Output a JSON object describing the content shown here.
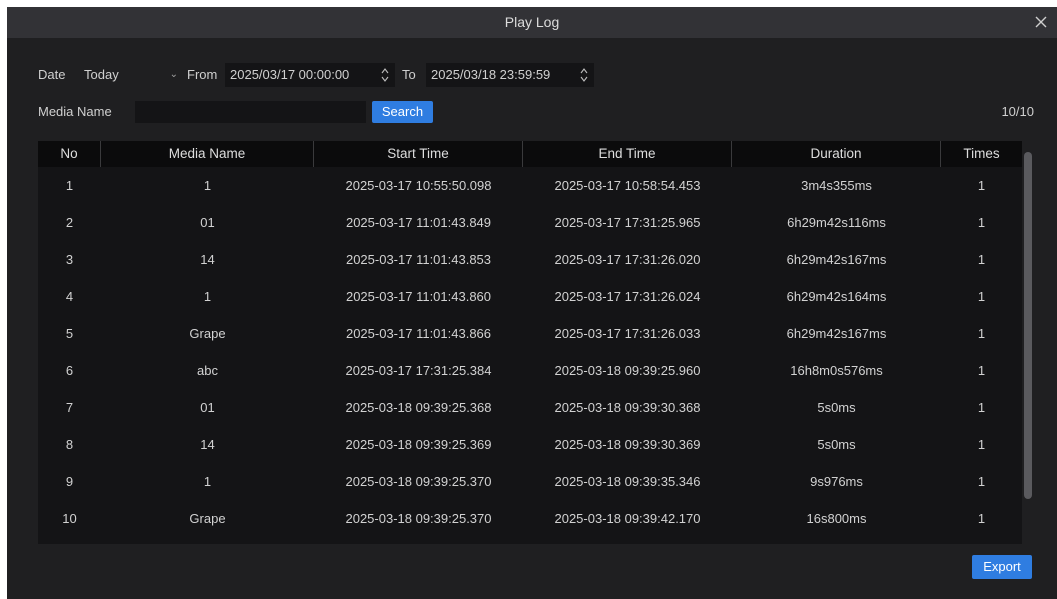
{
  "window": {
    "title": "Play Log"
  },
  "filters": {
    "date_label": "Date",
    "date_value": "Today",
    "from_label": "From",
    "from_value": "2025/03/17 00:00:00",
    "to_label": "To",
    "to_value": "2025/03/18 23:59:59",
    "media_name_label": "Media Name",
    "media_name_value": "",
    "search_label": "Search",
    "count": "10/10"
  },
  "table": {
    "columns": [
      "No",
      "Media Name",
      "Start Time",
      "End Time",
      "Duration",
      "Times"
    ],
    "rows": [
      [
        "1",
        "1",
        "2025-03-17 10:55:50.098",
        "2025-03-17 10:58:54.453",
        "3m4s355ms",
        "1"
      ],
      [
        "2",
        "01",
        "2025-03-17 11:01:43.849",
        "2025-03-17 17:31:25.965",
        "6h29m42s116ms",
        "1"
      ],
      [
        "3",
        "14",
        "2025-03-17 11:01:43.853",
        "2025-03-17 17:31:26.020",
        "6h29m42s167ms",
        "1"
      ],
      [
        "4",
        "1",
        "2025-03-17 11:01:43.860",
        "2025-03-17 17:31:26.024",
        "6h29m42s164ms",
        "1"
      ],
      [
        "5",
        "Grape",
        "2025-03-17 11:01:43.866",
        "2025-03-17 17:31:26.033",
        "6h29m42s167ms",
        "1"
      ],
      [
        "6",
        "abc",
        "2025-03-17 17:31:25.384",
        "2025-03-18 09:39:25.960",
        "16h8m0s576ms",
        "1"
      ],
      [
        "7",
        "01",
        "2025-03-18 09:39:25.368",
        "2025-03-18 09:39:30.368",
        "5s0ms",
        "1"
      ],
      [
        "8",
        "14",
        "2025-03-18 09:39:25.369",
        "2025-03-18 09:39:30.369",
        "5s0ms",
        "1"
      ],
      [
        "9",
        "1",
        "2025-03-18 09:39:25.370",
        "2025-03-18 09:39:35.346",
        "9s976ms",
        "1"
      ],
      [
        "10",
        "Grape",
        "2025-03-18 09:39:25.370",
        "2025-03-18 09:39:42.170",
        "16s800ms",
        "1"
      ]
    ]
  },
  "footer": {
    "export_label": "Export"
  },
  "icons": {
    "close": "close-icon",
    "dropdown": "chevron-down-icon",
    "spinner": "spinner-arrows-icon"
  },
  "colors": {
    "accent": "#2f7de1",
    "window_bg": "#1f1f21",
    "titlebar_bg": "#323236",
    "table_bg": "#141416",
    "header_bg": "#0b0b0c"
  }
}
